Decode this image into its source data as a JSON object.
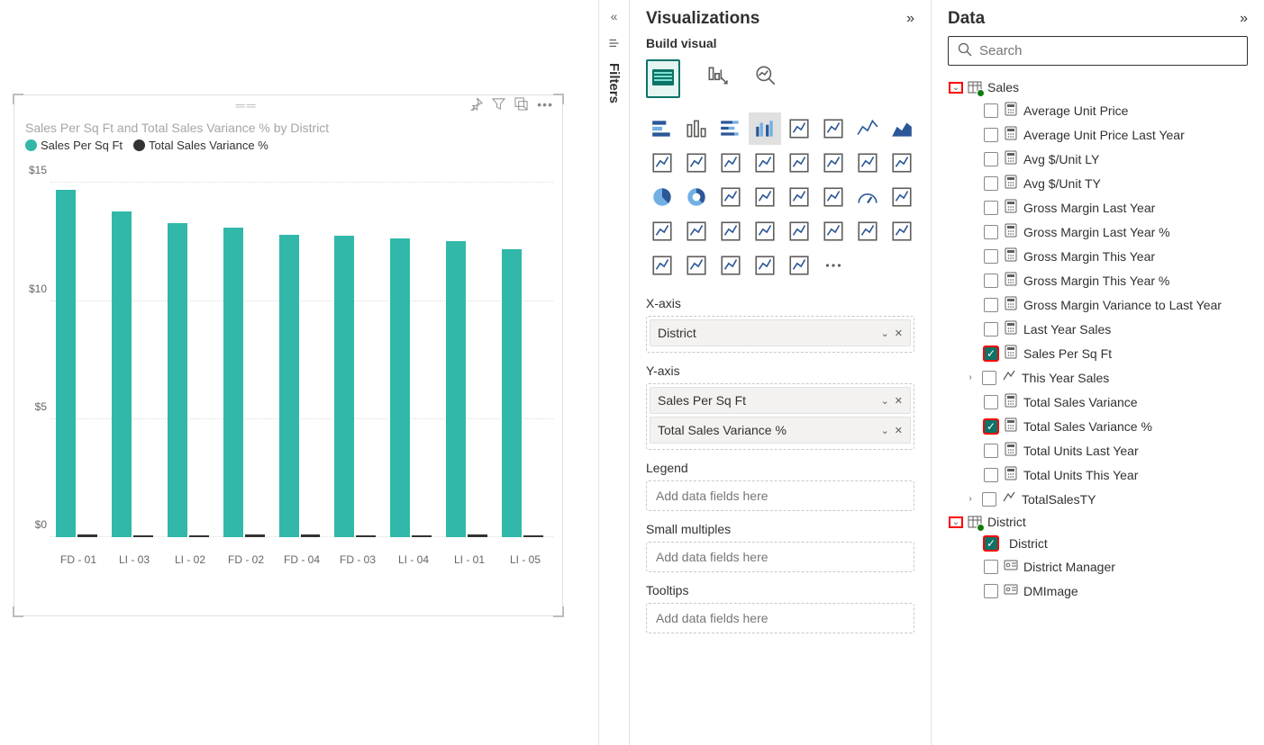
{
  "panels": {
    "viz_title": "Visualizations",
    "data_title": "Data",
    "build_label": "Build visual",
    "filters_label": "Filters"
  },
  "search": {
    "placeholder": "Search"
  },
  "chart_data": {
    "type": "bar",
    "title": "Sales Per Sq Ft and Total Sales Variance % by District",
    "series": [
      {
        "name": "Sales Per Sq Ft",
        "color": "#31b8a8",
        "values": [
          14.7,
          13.8,
          13.3,
          13.1,
          12.8,
          12.75,
          12.65,
          12.55,
          12.2
        ]
      },
      {
        "name": "Total Sales Variance %",
        "color": "#333333",
        "values": [
          -0.1,
          0,
          0,
          -0.1,
          0.1,
          -0.05,
          -0.05,
          -0.1,
          0
        ]
      }
    ],
    "categories": [
      "FD - 01",
      "LI - 03",
      "LI - 02",
      "FD - 02",
      "FD - 04",
      "FD - 03",
      "LI - 04",
      "LI - 01",
      "LI - 05"
    ],
    "ylabel": "",
    "xlabel": "",
    "yticks": [
      0,
      5,
      10,
      15
    ],
    "ylim": [
      0,
      16
    ]
  },
  "wells": {
    "xaxis": {
      "label": "X-axis",
      "items": [
        "District"
      ]
    },
    "yaxis": {
      "label": "Y-axis",
      "items": [
        "Sales Per Sq Ft",
        "Total Sales Variance %"
      ]
    },
    "legend": {
      "label": "Legend",
      "placeholder": "Add data fields here"
    },
    "small": {
      "label": "Small multiples",
      "placeholder": "Add data fields here"
    },
    "tooltips": {
      "label": "Tooltips",
      "placeholder": "Add data fields here"
    }
  },
  "viz_icons": [
    "stacked-bar-h",
    "clustered-bar-v",
    "stacked-bar-v",
    "clustered-column",
    "stacked-column-100",
    "bar-clustered-100",
    "line",
    "area",
    "line-stacked",
    "line-clustered",
    "bar-line-1",
    "bar-line-2",
    "ribbon",
    "waterfall",
    "funnel",
    "scatter",
    "pie",
    "donut",
    "treemap",
    "map",
    "filled-map",
    "azure-map",
    "gauge",
    "card",
    "multi-row",
    "kpi",
    "slicer",
    "table",
    "matrix",
    "r-visual",
    "py-visual",
    "key-influencers",
    "decomposition-tree",
    "qa",
    "paginated",
    "powerapps",
    "automate",
    "more"
  ],
  "data_tree": {
    "tables": [
      {
        "name": "Sales",
        "expanded": true,
        "highlight_chevron": true,
        "fields": [
          {
            "name": "Average Unit Price",
            "icon": "calc",
            "checked": false
          },
          {
            "name": "Average Unit Price Last Year",
            "icon": "calc",
            "checked": false
          },
          {
            "name": "Avg $/Unit LY",
            "icon": "calc",
            "checked": false
          },
          {
            "name": "Avg $/Unit TY",
            "icon": "calc",
            "checked": false
          },
          {
            "name": "Gross Margin Last Year",
            "icon": "calc",
            "checked": false
          },
          {
            "name": "Gross Margin Last Year %",
            "icon": "calc",
            "checked": false
          },
          {
            "name": "Gross Margin This Year",
            "icon": "calc",
            "checked": false
          },
          {
            "name": "Gross Margin This Year %",
            "icon": "calc",
            "checked": false
          },
          {
            "name": "Gross Margin Variance to Last Year",
            "icon": "calc",
            "checked": false
          },
          {
            "name": "Last Year Sales",
            "icon": "calc",
            "checked": false
          },
          {
            "name": "Sales Per Sq Ft",
            "icon": "calc",
            "checked": true,
            "highlight": true
          },
          {
            "name": "This Year Sales",
            "icon": "hier",
            "checked": false,
            "expandable": true
          },
          {
            "name": "Total Sales Variance",
            "icon": "calc",
            "checked": false
          },
          {
            "name": "Total Sales Variance %",
            "icon": "calc",
            "checked": true,
            "highlight": true
          },
          {
            "name": "Total Units Last Year",
            "icon": "calc",
            "checked": false
          },
          {
            "name": "Total Units This Year",
            "icon": "calc",
            "checked": false
          },
          {
            "name": "TotalSalesTY",
            "icon": "hier",
            "checked": false,
            "expandable": true
          }
        ]
      },
      {
        "name": "District",
        "expanded": true,
        "highlight_chevron": true,
        "fields": [
          {
            "name": "District",
            "icon": "none",
            "checked": true,
            "highlight": true
          },
          {
            "name": "District Manager",
            "icon": "card",
            "checked": false
          },
          {
            "name": "DMImage",
            "icon": "card",
            "checked": false
          }
        ]
      }
    ]
  }
}
